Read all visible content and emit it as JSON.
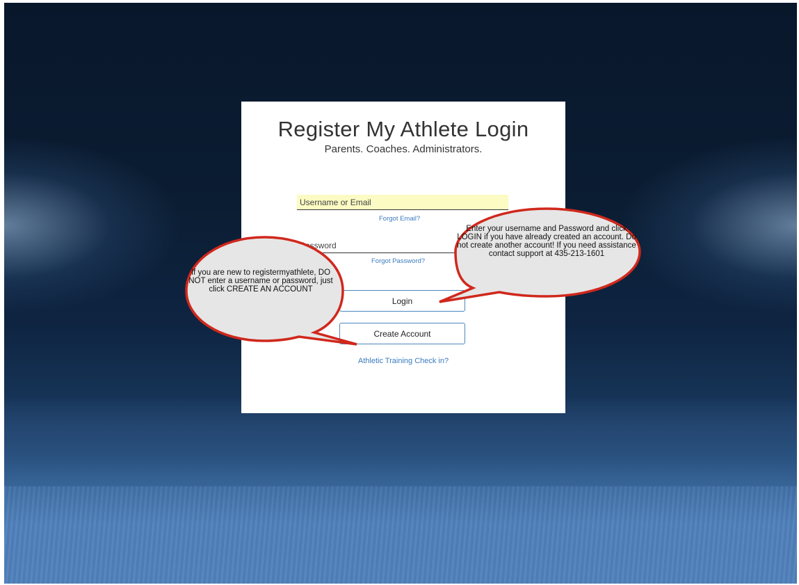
{
  "login": {
    "title": "Register My Athlete Login",
    "subtitle": "Parents. Coaches. Administrators.",
    "username_placeholder": "Username or Email",
    "forgot_email": "Forgot Email?",
    "password_placeholder": "Password",
    "forgot_password": "Forgot Password?",
    "login_button": "Login",
    "create_account_button": "Create Account",
    "training_checkin": "Athletic Training Check in?"
  },
  "callouts": {
    "left": "If you are new to registermyathlete, DO NOT enter a username or password, just click CREATE AN ACCOUNT",
    "right": "Enter your username and Password and click LOGIN if you have already created an account.  Do not create another account!  If you need assistance contact support at 435-213-1601"
  },
  "colors": {
    "link": "#3b7bbf",
    "button_border": "#4a86c0",
    "callout_border": "#d0281c",
    "callout_fill": "#e6e6e6",
    "autofill_background": "#fbfbc3"
  }
}
